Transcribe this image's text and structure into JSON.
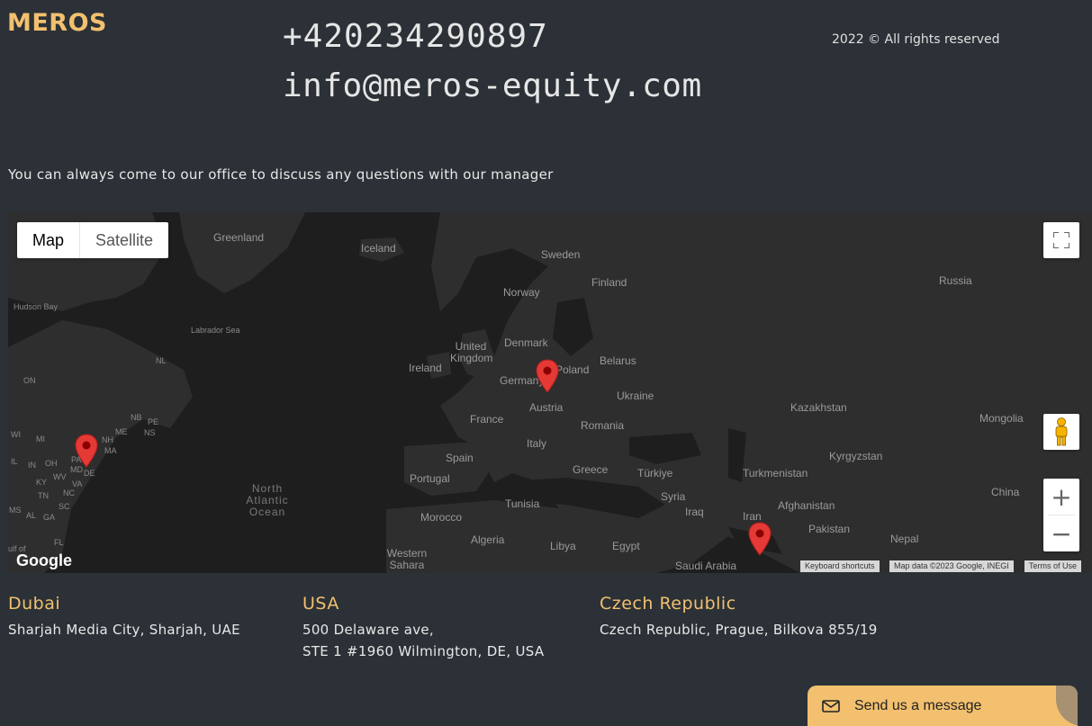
{
  "header": {
    "logo": "MEROS",
    "phone": "+420234290897",
    "email": "info@meros-equity.com",
    "copyright": "2022 © All rights reserved"
  },
  "intro": "You can always come to our office to discuss any questions with our manager",
  "map": {
    "type_buttons": [
      "Map",
      "Satellite"
    ],
    "selected_type": "Map",
    "labels": {
      "greenland": "Greenland",
      "iceland": "Iceland",
      "sweden": "Sweden",
      "finland": "Finland",
      "norway": "Norway",
      "russia": "Russia",
      "hudson_bay": "Hudson Bay",
      "labrador_sea": "Labrador Sea",
      "denmark": "Denmark",
      "united_kingdom": "United Kingdom",
      "ireland": "Ireland",
      "belarus": "Belarus",
      "germany": "Germany",
      "poland": "Poland",
      "ukraine": "Ukraine",
      "kazakhstan": "Kazakhstan",
      "france": "France",
      "austria": "Austria",
      "romania": "Romania",
      "mongolia": "Mongolia",
      "italy": "Italy",
      "spain": "Spain",
      "portugal": "Portugal",
      "greece": "Greece",
      "turkiye": "Türkiye",
      "turkmenistan": "Turkmenistan",
      "kyrgyzstan": "Kyrgyzstan",
      "north_atlantic_ocean": "North Atlantic Ocean",
      "tunisia": "Tunisia",
      "syria": "Syria",
      "iraq": "Iraq",
      "afghanistan": "Afghanistan",
      "china": "China",
      "morocco": "Morocco",
      "iran": "Iran",
      "pakistan": "Pakistan",
      "algeria": "Algeria",
      "libya": "Libya",
      "egypt": "Egypt",
      "nepal": "Nepal",
      "western_sahara": "Western Sahara",
      "saudi_arabia": "Saudi Arabia",
      "on": "ON",
      "nl": "NL",
      "nb": "NB",
      "pe": "PE",
      "me": "ME",
      "ns": "NS",
      "nh": "NH",
      "ma": "MA",
      "wi": "WI",
      "mi": "MI",
      "pa": "PA",
      "il": "IL",
      "in": "IN",
      "oh": "OH",
      "md": "MD",
      "de": "DE",
      "wv": "WV",
      "va": "VA",
      "ky": "KY",
      "tn": "TN",
      "nc": "NC",
      "ms": "MS",
      "al": "AL",
      "ga": "GA",
      "sc": "SC",
      "fl": "FL",
      "gulf": "ulf of"
    },
    "google": "Google",
    "attributions": [
      "Keyboard shortcuts",
      "Map data ©2023 Google, INEGI",
      "Terms of Use"
    ]
  },
  "offices": [
    {
      "name": "Dubai",
      "lines": [
        "Sharjah Media City, Sharjah, UAE"
      ]
    },
    {
      "name": "USA",
      "lines": [
        "500 Delaware ave,",
        "STE 1 #1960 Wilmington, DE, USA"
      ]
    },
    {
      "name": "Czech Republic",
      "lines": [
        "Czech Republic, Prague, Bilkova 855/19"
      ]
    }
  ],
  "chat": {
    "label": "Send us a message"
  },
  "colors": {
    "accent": "#f2c06f",
    "background": "#2b3136",
    "pin": "#e53935"
  }
}
